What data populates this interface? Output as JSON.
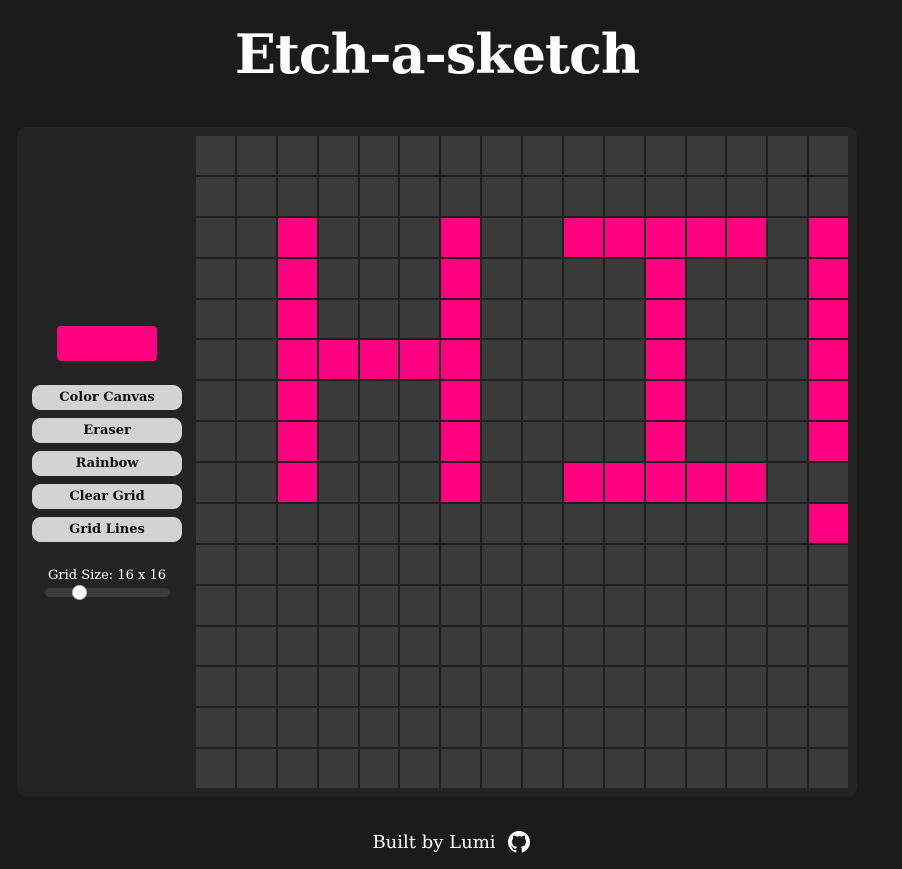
{
  "page": {
    "title": "Etch-a-sketch"
  },
  "controls": {
    "swatch_color": "#ff0080",
    "buttons": [
      "Color Canvas",
      "Eraser",
      "Rainbow",
      "Clear Grid",
      "Grid Lines"
    ],
    "grid_size_label": "Grid Size: 16 x 16",
    "grid_size_value": 16,
    "grid_size_min": 1,
    "grid_size_max": 64
  },
  "grid": {
    "size": 16,
    "empty_color": "#3a3a3a",
    "line_color": "#1f1f1f",
    "paint_color": "#ff0080",
    "rows": [
      "................",
      "................",
      "..#...#..#####.#",
      "..#...#....#...#",
      "..#...#....#...#",
      "..#####....#...#",
      "..#...#....#...#",
      "..#...#....#...#",
      "..#...#..#####..",
      "...............#",
      "................",
      "................",
      "................",
      "................",
      "................",
      "................"
    ]
  },
  "footer": {
    "text": "Built by Lumi",
    "icon": "github-icon"
  }
}
